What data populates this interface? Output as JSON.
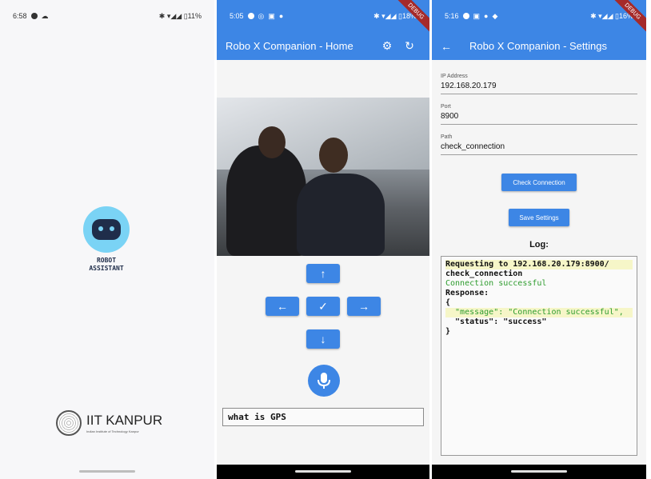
{
  "screen1": {
    "status": {
      "time": "6:58",
      "right": "✱ ▾◢◢ ▯11%"
    },
    "logo_text_line1": "ROBOT",
    "logo_text_line2": "ASSISTANT",
    "iit_title": "IIT KANPUR",
    "iit_subtitle": "Indian Institute of Technology Kanpur"
  },
  "screen2": {
    "status": {
      "time": "5:05",
      "right": "✱ ▾◢◢ ▯18%"
    },
    "debug_label": "DEBUG",
    "appbar_title": "Robo X Companion - Home",
    "controls": {
      "up": "↑",
      "left": "←",
      "center": "✓",
      "right": "→",
      "down": "↓"
    },
    "command_text": "what is GPS"
  },
  "screen3": {
    "status": {
      "time": "5:16",
      "right": "✱ ▾◢◢ ▯16%"
    },
    "debug_label": "DEBUG",
    "appbar_title": "Robo X Companion - Settings",
    "fields": [
      {
        "label": "IP Address",
        "value": "192.168.20.179"
      },
      {
        "label": "Port",
        "value": "8900"
      },
      {
        "label": "Path",
        "value": "check_connection"
      }
    ],
    "check_button": "Check Connection",
    "save_button": "Save Settings",
    "log_label": "Log:",
    "log": {
      "line1": "Requesting to 192.168.20.179:8900/",
      "line2": "check_connection",
      "line3": "Connection successful",
      "line4": "Response:",
      "line5": "{",
      "line6": "  \"message\": \"Connection successful\",",
      "line7": "  \"status\": \"success\"",
      "line8": "}"
    }
  },
  "colors": {
    "primary": "#3d86e5",
    "success": "#2e9c2e",
    "debug": "#a52a2a"
  }
}
